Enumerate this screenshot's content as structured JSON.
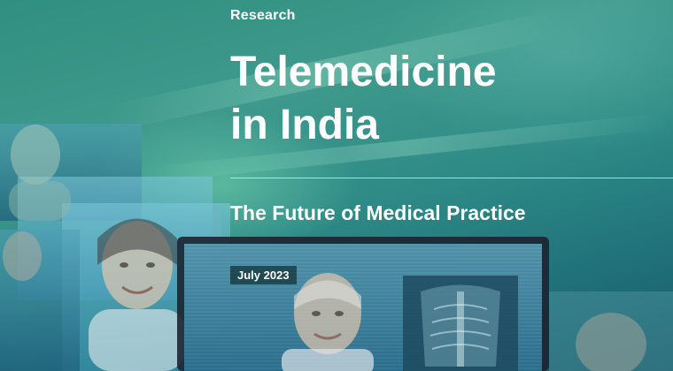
{
  "cover": {
    "category": "Research",
    "title_line1": "Telemedicine",
    "title_line2": "in India",
    "subtitle": "The Future of Medical Practice",
    "date": "July 2023"
  },
  "colors": {
    "text": "#ffffff",
    "background_top": "#3f9a8c",
    "background_bottom": "#175a66",
    "badge_background": "#14373c"
  }
}
